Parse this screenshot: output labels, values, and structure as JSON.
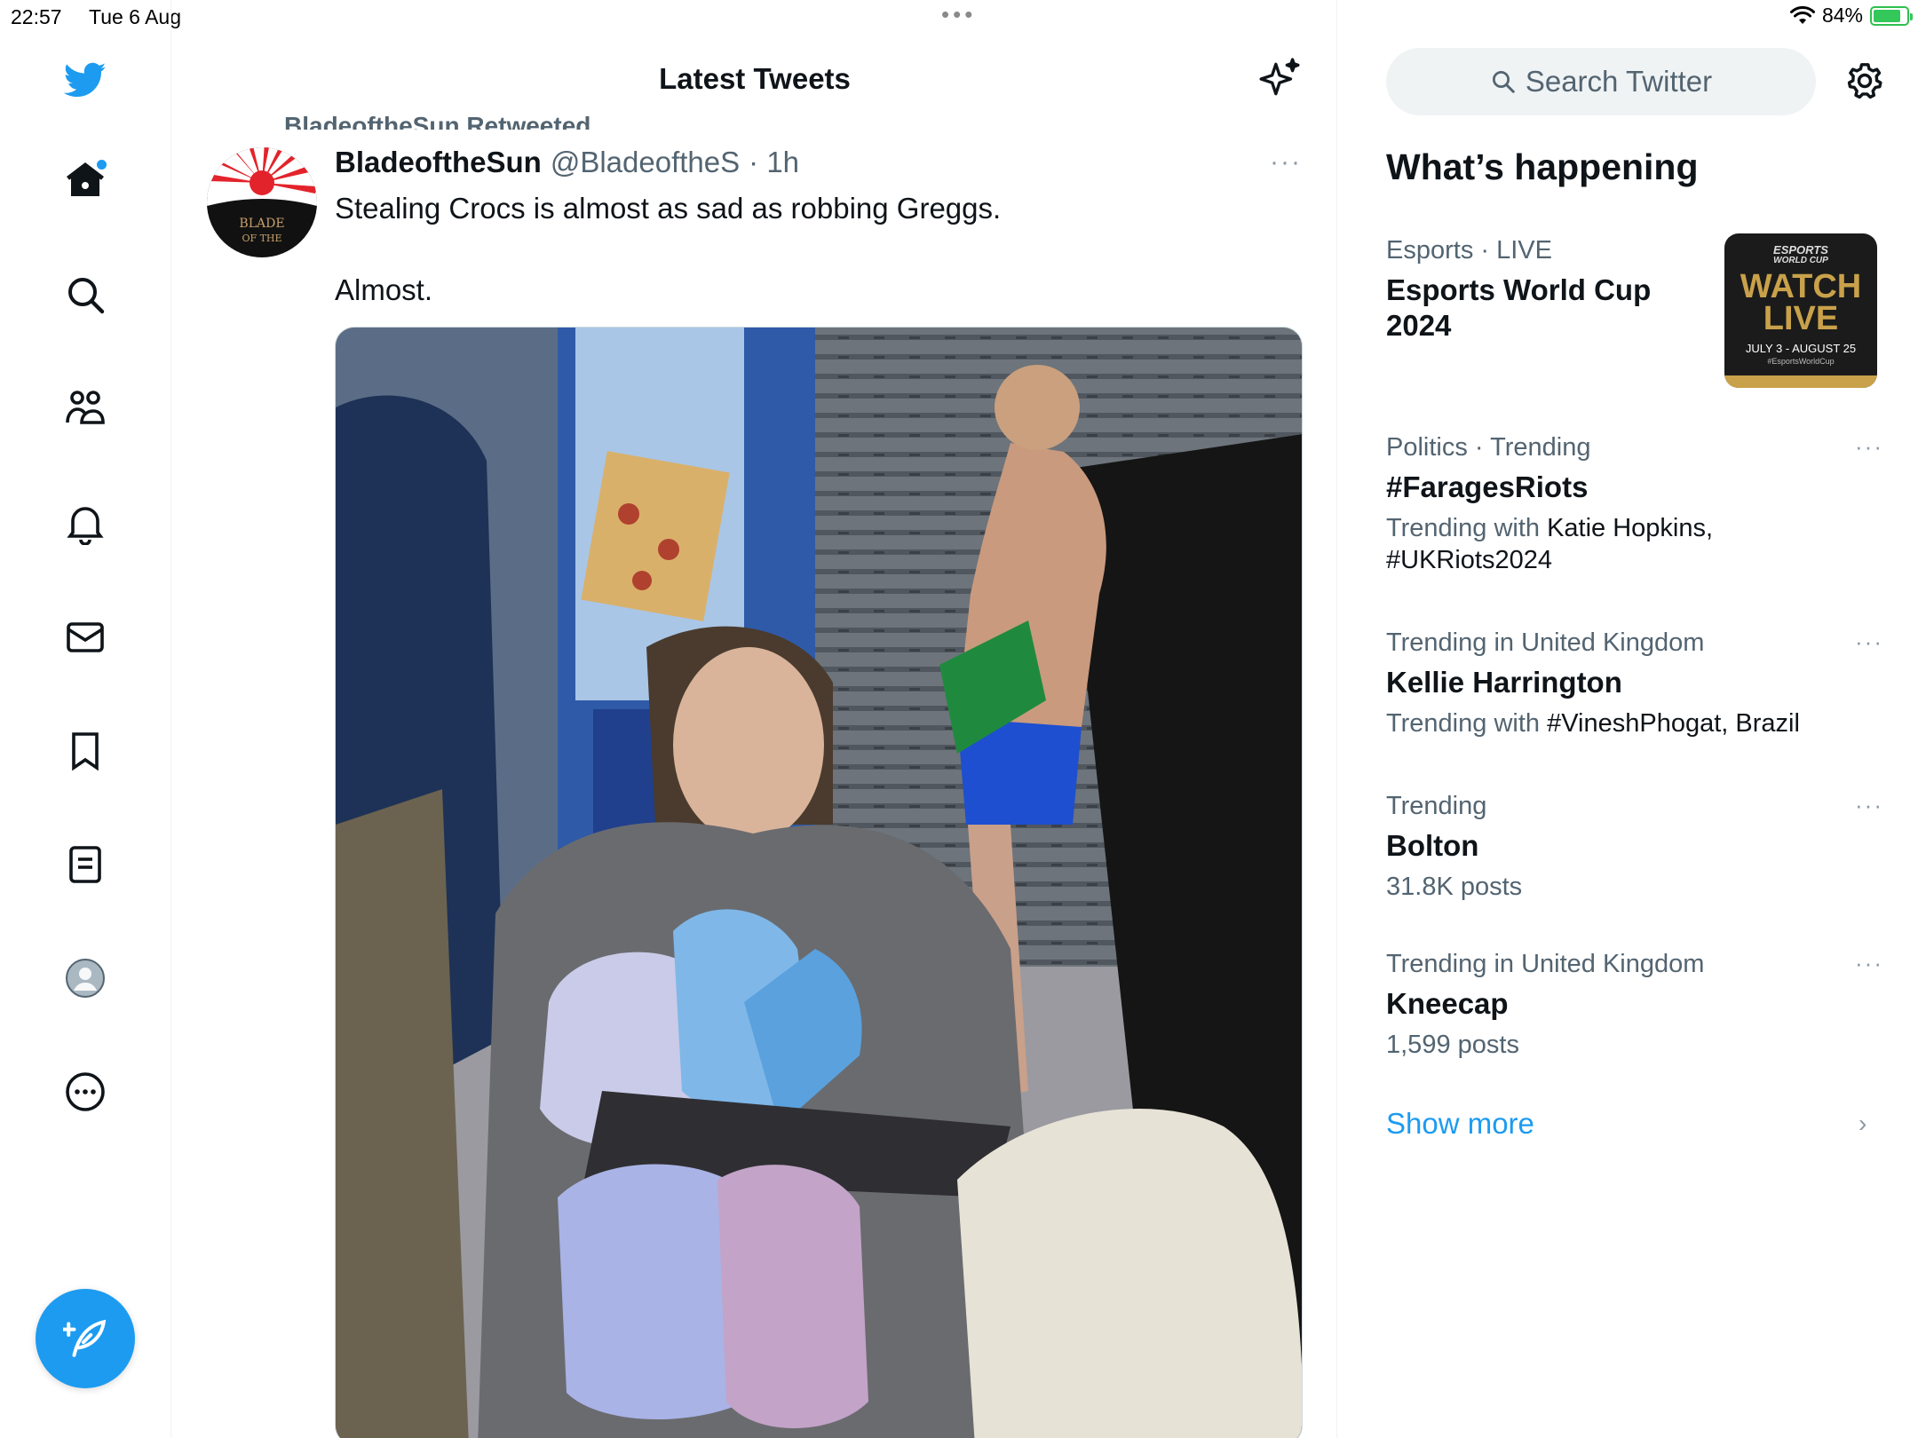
{
  "status_bar": {
    "time": "22:57",
    "date": "Tue 6 Aug",
    "battery": "84%",
    "battery_level": 0.84
  },
  "header": {
    "title": "Latest Tweets"
  },
  "nav": {
    "items": [
      "home-icon",
      "search-icon",
      "communities-icon",
      "notifications-icon",
      "messages-icon",
      "bookmarks-icon",
      "lists-icon",
      "profile-icon",
      "more-icon"
    ],
    "compose": "compose-icon"
  },
  "tweet": {
    "retweeted_by": "BladeoftheSun Retweeted",
    "author_name": "BladeoftheSun",
    "author_handle": "@BladeoftheS",
    "time": "· 1h",
    "more": "···",
    "text": "Stealing Crocs is almost as sad as robbing Greggs.\n\nAlmost.",
    "avatar_text": "BLADE OF THE"
  },
  "search": {
    "placeholder": "Search Twitter"
  },
  "whats_happening": {
    "title": "What’s happening",
    "trends": [
      {
        "meta": "Esports · LIVE",
        "name": "Esports World Cup 2024",
        "sub": ""
      },
      {
        "meta": "Politics · Trending",
        "name": "#FaragesRiots",
        "sub_prefix": "Trending with ",
        "sub": "Katie Hopkins, #UKRiots2024"
      },
      {
        "meta": "Trending in United Kingdom",
        "name": "Kellie Harrington",
        "sub_prefix": "Trending with ",
        "sub": "#VineshPhogat, Brazil"
      },
      {
        "meta": "Trending",
        "name": "Bolton",
        "sub": "31.8K posts"
      },
      {
        "meta": "Trending in United Kingdom",
        "name": "Kneecap",
        "sub": "1,599 posts"
      }
    ],
    "show_more": "Show more",
    "thumb": {
      "line1": "ESPORTS",
      "line2": "WORLD CUP",
      "line3": "WATCH",
      "line4": "LIVE",
      "line5": "JULY 3 - AUGUST 25",
      "line6": "#EsportsWorldCup"
    }
  }
}
